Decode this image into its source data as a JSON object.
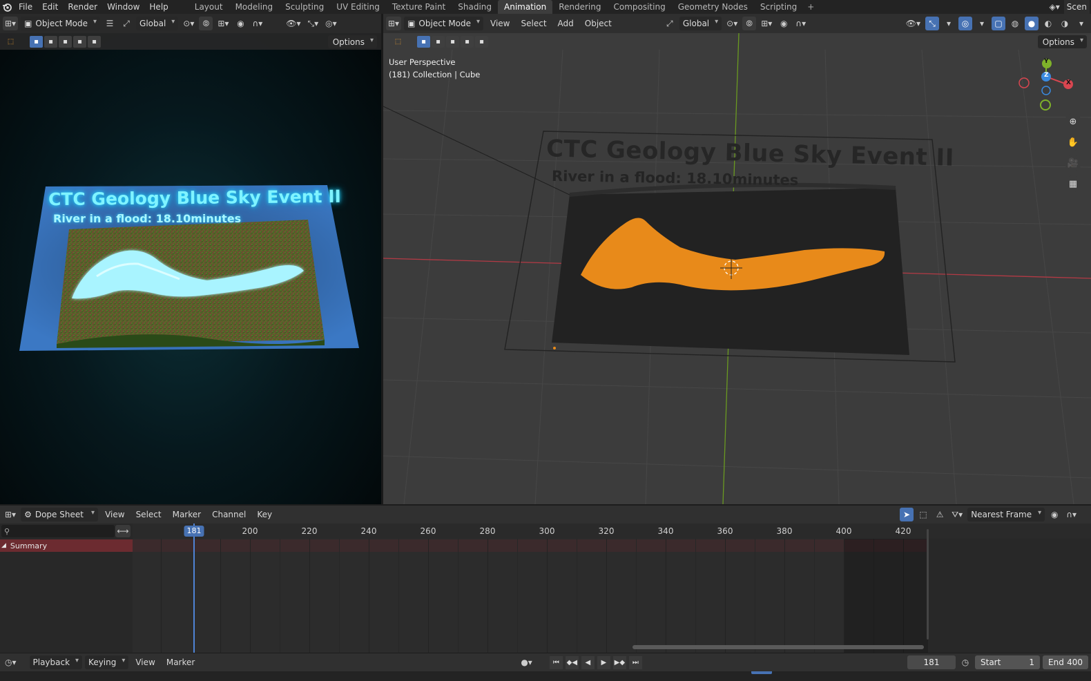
{
  "top_menu": [
    "File",
    "Edit",
    "Render",
    "Window",
    "Help"
  ],
  "workspaces": [
    {
      "label": "Layout",
      "active": false
    },
    {
      "label": "Modeling",
      "active": false
    },
    {
      "label": "Sculpting",
      "active": false
    },
    {
      "label": "UV Editing",
      "active": false
    },
    {
      "label": "Texture Paint",
      "active": false
    },
    {
      "label": "Shading",
      "active": false
    },
    {
      "label": "Animation",
      "active": true
    },
    {
      "label": "Rendering",
      "active": false
    },
    {
      "label": "Compositing",
      "active": false
    },
    {
      "label": "Geometry Nodes",
      "active": false
    },
    {
      "label": "Scripting",
      "active": false
    }
  ],
  "scene_label": "Scen",
  "left_viewport": {
    "mode": "Object Mode",
    "orientation": "Global",
    "options_label": "Options",
    "render_title": "CTC Geology Blue Sky Event II",
    "render_subtitle": "River in a flood: 18.10minutes"
  },
  "right_viewport": {
    "mode": "Object Mode",
    "menus": [
      "View",
      "Select",
      "Add",
      "Object"
    ],
    "orientation": "Global",
    "options_label": "Options",
    "perspective_label": "User Perspective",
    "collection_label": "(181) Collection | Cube",
    "scene_title": "CTC Geology Blue Sky Event II",
    "scene_subtitle": "River in a flood: 18.10minutes",
    "axes": {
      "x": "X",
      "y": "Y",
      "z": "Z"
    }
  },
  "dopesheet": {
    "editor_mode": "Dope Sheet",
    "menus": [
      "View",
      "Select",
      "Marker",
      "Channel",
      "Key"
    ],
    "snapping": "Nearest Frame",
    "summary_label": "Summary",
    "current_frame": "181",
    "ticks": [
      "200",
      "220",
      "240",
      "260",
      "280",
      "300",
      "320",
      "340",
      "360",
      "380",
      "400",
      "420"
    ]
  },
  "timeline": {
    "playback_label": "Playback",
    "keying_label": "Keying",
    "menus": [
      "View",
      "Marker"
    ],
    "current_frame": "181",
    "start_label": "Start",
    "start_value": "1",
    "end_label": "End",
    "end_value": "400"
  },
  "colors": {
    "accent": "#4772b3",
    "selected_orange": "#e88a1a",
    "glow_cyan": "#7ff3ff",
    "summary_red": "#6c2b30"
  }
}
